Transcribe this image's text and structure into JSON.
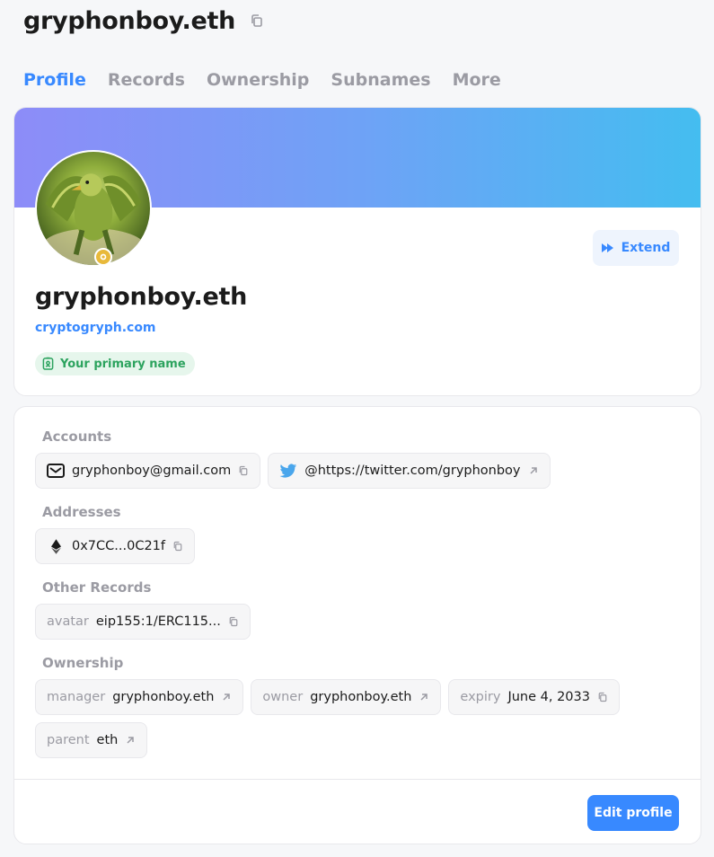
{
  "header": {
    "title": "gryphonboy.eth",
    "copy_icon": "copy-icon"
  },
  "tabs": [
    {
      "label": "Profile",
      "active": true
    },
    {
      "label": "Records",
      "active": false
    },
    {
      "label": "Ownership",
      "active": false
    },
    {
      "label": "Subnames",
      "active": false
    },
    {
      "label": "More",
      "active": false
    }
  ],
  "profile": {
    "name": "gryphonboy.eth",
    "website": "cryptogryph.com",
    "primary_badge": "Your primary name",
    "extend_label": "Extend",
    "banner_colors": [
      "#8d8cf8",
      "#44bdf0"
    ]
  },
  "records": {
    "accounts_label": "Accounts",
    "accounts": [
      {
        "icon": "mail-icon",
        "value": "gryphonboy@gmail.com",
        "action": "copy-icon"
      },
      {
        "icon": "twitter-icon",
        "value": "@https://twitter.com/gryphonboy",
        "action": "external-link-icon"
      }
    ],
    "addresses_label": "Addresses",
    "addresses": [
      {
        "icon": "ethereum-icon",
        "value": "0x7CC...0C21f",
        "action": "copy-icon"
      }
    ],
    "other_label": "Other Records",
    "other": [
      {
        "key": "avatar",
        "value": "eip155:1/ERC115...",
        "action": "copy-icon"
      }
    ],
    "ownership_label": "Ownership",
    "ownership": [
      {
        "key": "manager",
        "value": "gryphonboy.eth",
        "action": "external-link-icon"
      },
      {
        "key": "owner",
        "value": "gryphonboy.eth",
        "action": "external-link-icon"
      },
      {
        "key": "expiry",
        "value": "June 4, 2033",
        "action": "copy-icon"
      },
      {
        "key": "parent",
        "value": "eth",
        "action": "external-link-icon"
      }
    ],
    "edit_label": "Edit profile"
  },
  "colors": {
    "accent": "#3889ff",
    "muted": "#9b9ba3",
    "success": "#2ca35e"
  }
}
